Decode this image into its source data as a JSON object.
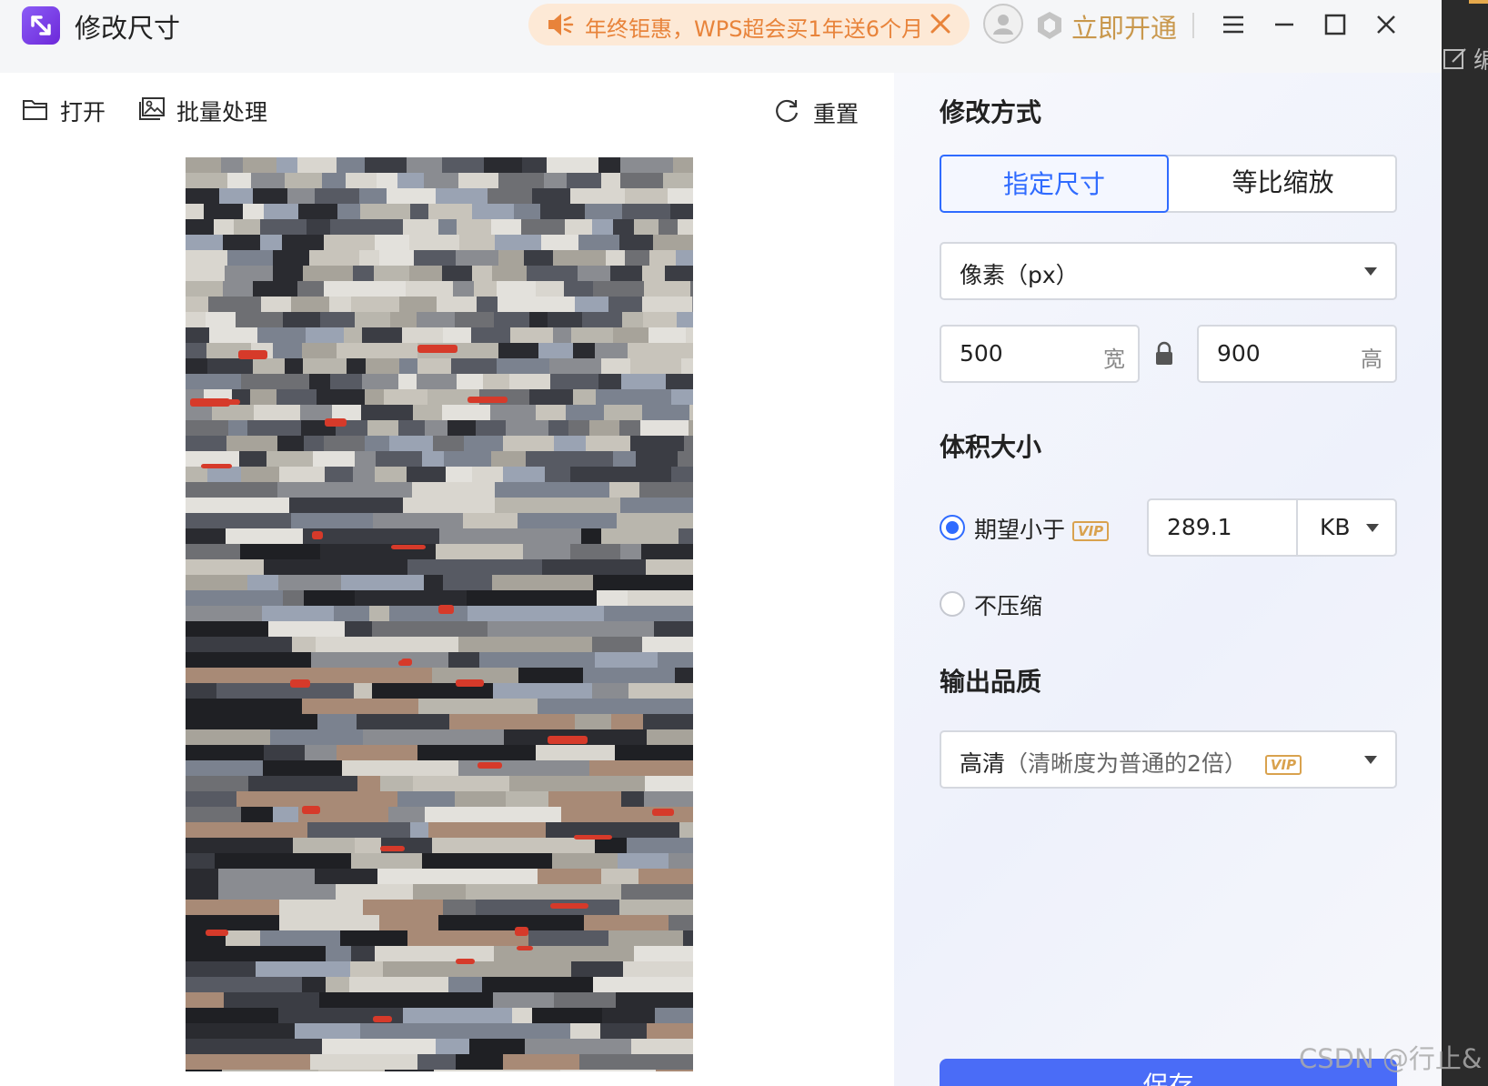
{
  "window": {
    "title": "修改尺寸",
    "promo_text": "年终钜惠，WPS超会买1年送6个月",
    "open_vip_label": "立即开通"
  },
  "toolbar": {
    "open_label": "打开",
    "batch_label": "批量处理",
    "reset_label": "重置"
  },
  "panel": {
    "method_title": "修改方式",
    "tabs": [
      {
        "label": "指定尺寸",
        "active": true
      },
      {
        "label": "等比缩放",
        "active": false
      }
    ],
    "unit_select": {
      "value": "像素（px）"
    },
    "width": {
      "value": "500",
      "unit": "宽"
    },
    "height": {
      "value": "900",
      "unit": "高"
    },
    "size_title": "体积大小",
    "size_options": [
      {
        "label": "期望小于",
        "selected": true,
        "vip": "VIP"
      },
      {
        "label": "不压缩",
        "selected": false
      }
    ],
    "size_value": "289.1",
    "size_unit": "KB",
    "quality_title": "输出品质",
    "quality_select": {
      "value": "高清",
      "hint": "（清晰度为普通的2倍）",
      "vip": "VIP"
    },
    "save_label": "保存"
  },
  "right_strip_text": "编",
  "watermark": "CSDN @行止&",
  "colors": {
    "accent": "#2f6bff",
    "save_button": "#4a6cf7",
    "promo_text": "#e8833a",
    "vip": "#d9a24e"
  }
}
